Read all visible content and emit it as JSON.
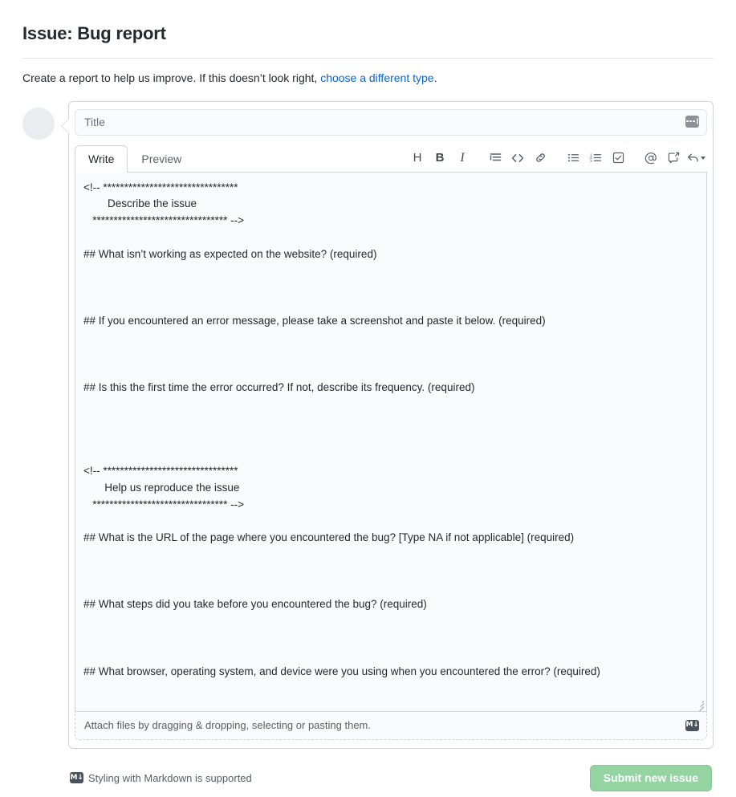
{
  "header": {
    "title": "Issue: Bug report",
    "subtitle_prefix": "Create a report to help us improve. If this doesn’t look right, ",
    "subtitle_link": "choose a different type",
    "subtitle_suffix": "."
  },
  "composer": {
    "title_field": {
      "value": "",
      "placeholder": "Title"
    },
    "tabs": [
      {
        "label": "Write",
        "active": true
      },
      {
        "label": "Preview",
        "active": false
      }
    ],
    "toolbar": [
      {
        "name": "heading-icon",
        "glyph": "H",
        "title": "Add heading text"
      },
      {
        "name": "bold-icon",
        "glyph": "B",
        "title": "Add bold text"
      },
      {
        "name": "italic-icon",
        "glyph": "I",
        "title": "Add italic text"
      },
      {
        "name": "quote-icon",
        "title": "Insert a quote"
      },
      {
        "name": "code-icon",
        "title": "Insert code"
      },
      {
        "name": "link-icon",
        "title": "Add a link"
      },
      {
        "name": "unordered-list-icon",
        "title": "Add a bulleted list"
      },
      {
        "name": "ordered-list-icon",
        "title": "Add a numbered list"
      },
      {
        "name": "task-list-icon",
        "title": "Add a task list"
      },
      {
        "name": "mention-icon",
        "title": "Directly mention a user or team"
      },
      {
        "name": "reference-icon",
        "title": "Reference an issue, pull request, or discussion"
      },
      {
        "name": "saved-reply-icon",
        "title": "Add saved reply"
      }
    ],
    "body_value": "<!-- ********************************\n        Describe the issue\n   ******************************** -->\n\n## What isn’t working as expected on the website? (required)\n\n\n\n## If you encountered an error message, please take a screenshot and paste it below. (required)\n\n\n\n## Is this the first time the error occurred? If not, describe its frequency. (required)\n\n\n\n\n<!-- ********************************\n       Help us reproduce the issue\n   ******************************** -->\n\n## What is the URL of the page where you encountered the bug? [Type NA if not applicable] (required)\n\n\n\n## What steps did you take before you encountered the bug? (required)\n\n\n\n## What browser, operating system, and device were you using when you encountered the error? (required)\n",
    "attach_text": "Attach files by dragging & dropping, selecting or pasting them.",
    "markdown_badge": "M↓"
  },
  "footer": {
    "markdown_note": "Styling with Markdown is supported",
    "submit_label": "Submit new issue"
  },
  "colors": {
    "link": "#0366d6",
    "submit_disabled_green": "#94d3a2",
    "border": "#d1d5da",
    "muted_text": "#586069"
  }
}
